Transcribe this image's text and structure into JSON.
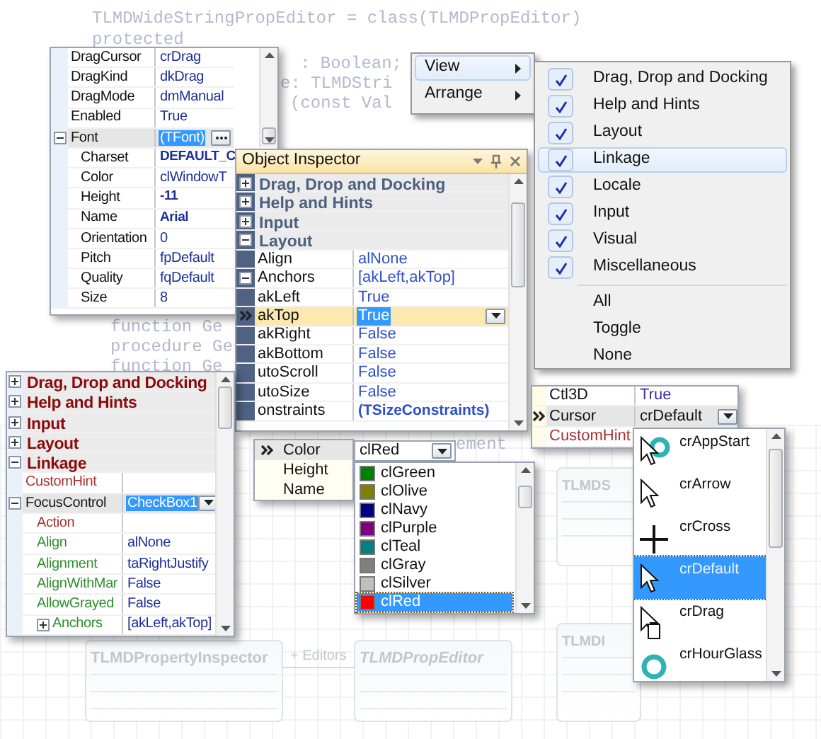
{
  "background_code": [
    "TLMDWideStringPropEditor = class(TLMDPropEditor)",
    "protected",
    ": Boolean;",
    "e: TLMDStri",
    "(const Val",
    "function Ge",
    "procedure Ge",
    "function Ge",
    "ement"
  ],
  "class_diagram": {
    "classes": [
      "TLMDPropertyInspector",
      "TLMDPropEditor",
      "TLMDS",
      "TLMDI"
    ],
    "association_label": "+ Editors"
  },
  "font_properties": {
    "rows": [
      {
        "name": "DragCursor",
        "value": "crDrag",
        "selected": false
      },
      {
        "name": "DragKind",
        "value": "dkDrag",
        "selected": false
      },
      {
        "name": "DragMode",
        "value": "dmManual",
        "selected": false
      },
      {
        "name": "Enabled",
        "value": "True",
        "selected": false
      },
      {
        "name": "Font",
        "value": "(TFont)",
        "selected": true,
        "kind": "ellipsis",
        "expanded": true,
        "children": [
          {
            "name": "Charset",
            "value": "DEFAULT_C",
            "modified": true,
            "selected": false
          },
          {
            "name": "Color",
            "value": "clWindowT",
            "selected": false
          },
          {
            "name": "Height",
            "value": "-11",
            "modified": true,
            "selected": false
          },
          {
            "name": "Name",
            "value": "Arial",
            "modified": true,
            "selected": false
          },
          {
            "name": "Orientation",
            "value": "0",
            "selected": false
          },
          {
            "name": "Pitch",
            "value": "fpDefault",
            "selected": false
          },
          {
            "name": "Quality",
            "value": "fqDefault",
            "selected": false
          },
          {
            "name": "Size",
            "value": "8",
            "selected": false
          }
        ]
      }
    ]
  },
  "context_menu": {
    "items": [
      {
        "label": "View",
        "selected": true
      },
      {
        "label": "Arrange",
        "selected": false
      }
    ]
  },
  "view_submenu": {
    "items": [
      {
        "label": "Drag, Drop and Docking",
        "checked": true,
        "selected": false
      },
      {
        "label": "Help and Hints",
        "checked": true,
        "selected": false
      },
      {
        "label": "Layout",
        "checked": true,
        "selected": false
      },
      {
        "label": "Linkage",
        "checked": true,
        "selected": true
      },
      {
        "label": "Locale",
        "checked": true,
        "selected": false
      },
      {
        "label": "Input",
        "checked": true,
        "selected": false
      },
      {
        "label": "Visual",
        "checked": true,
        "selected": false
      },
      {
        "label": "Miscellaneous",
        "checked": true,
        "selected": false
      }
    ],
    "actions": [
      "All",
      "Toggle",
      "None"
    ]
  },
  "object_inspector": {
    "title": "Object Inspector",
    "categories": [
      {
        "name": "Drag, Drop and Docking",
        "expanded": false
      },
      {
        "name": "Help and Hints",
        "expanded": false
      },
      {
        "name": "Input",
        "expanded": false
      },
      {
        "name": "Layout",
        "expanded": true,
        "properties": [
          {
            "name": "Align",
            "value": "alNone",
            "selected": false
          },
          {
            "name": "Anchors",
            "value": "[akLeft,akTop]",
            "selected": false,
            "expanded": true,
            "children": [
              {
                "name": "akLeft",
                "value": "True",
                "selected": false
              },
              {
                "name": "akTop",
                "value": "True",
                "selected": true,
                "kind": "dropdown"
              },
              {
                "name": "akRight",
                "value": "False",
                "selected": false
              },
              {
                "name": "akBottom",
                "value": "False",
                "selected": false
              }
            ]
          },
          {
            "name": "utoScroll",
            "value": "False",
            "selected": false
          },
          {
            "name": "utoSize",
            "value": "False",
            "selected": false
          },
          {
            "name": "onstraints",
            "value": "(TSizeConstraints)",
            "modified": true,
            "selected": false
          }
        ]
      }
    ]
  },
  "linkage_inspector": {
    "categories": [
      {
        "name": "Drag, Drop and Docking",
        "expanded": false
      },
      {
        "name": "Help and Hints",
        "expanded": false
      },
      {
        "name": "Input",
        "expanded": false
      },
      {
        "name": "Layout",
        "expanded": false
      },
      {
        "name": "Linkage",
        "expanded": true,
        "properties": [
          {
            "name": "CustomHint",
            "color": "#a83232",
            "selected": false
          },
          {
            "name": "FocusControl",
            "value": "CheckBox1",
            "color": "#1a1a1a",
            "selected": true,
            "kind": "dropdown",
            "expanded": true,
            "children": [
              {
                "name": "Action",
                "color": "#a83232",
                "selected": false
              },
              {
                "name": "Align",
                "value": "alNone",
                "color": "#2f8f2f",
                "selected": false
              },
              {
                "name": "Alignment",
                "value": "taRightJustify",
                "color": "#2f8f2f",
                "selected": false
              },
              {
                "name": "AlignWithMar",
                "value": "False",
                "color": "#2f8f2f",
                "selected": false
              },
              {
                "name": "AllowGrayed",
                "value": "False",
                "color": "#2f8f2f",
                "selected": false
              },
              {
                "name": "Anchors",
                "value": "[akLeft,akTop]",
                "color": "#2f8f2f",
                "selected": false,
                "expanded": false
              }
            ]
          }
        ]
      }
    ]
  },
  "font_color_editor": {
    "properties": [
      {
        "name": "Color",
        "selected": true
      },
      {
        "name": "Height",
        "selected": false
      },
      {
        "name": "Name",
        "selected": false
      }
    ],
    "value": "clRed",
    "options": [
      {
        "label": "clGreen",
        "color": "#008000",
        "selected": false
      },
      {
        "label": "clOlive",
        "color": "#808000",
        "selected": false
      },
      {
        "label": "clNavy",
        "color": "#000080",
        "selected": false
      },
      {
        "label": "clPurple",
        "color": "#800080",
        "selected": false
      },
      {
        "label": "clTeal",
        "color": "#008080",
        "selected": false
      },
      {
        "label": "clGray",
        "color": "#808080",
        "selected": false
      },
      {
        "label": "clSilver",
        "color": "#c0c0c0",
        "selected": false
      },
      {
        "label": "clRed",
        "color": "#ff0000",
        "selected": true
      }
    ]
  },
  "cursor_editor": {
    "properties": [
      {
        "name": "Ctl3D",
        "value": "True",
        "selected": false
      },
      {
        "name": "Cursor",
        "value": "crDefault",
        "selected": true,
        "kind": "dropdown"
      },
      {
        "name": "CustomHint",
        "color": "#a83232",
        "selected": false
      }
    ],
    "options": [
      {
        "label": "crAppStart",
        "kind": "appstart",
        "selected": false
      },
      {
        "label": "crArrow",
        "kind": "arrow",
        "selected": false
      },
      {
        "label": "crCross",
        "kind": "cross",
        "selected": false
      },
      {
        "label": "crDefault",
        "kind": "arrow",
        "selected": true
      },
      {
        "label": "crDrag",
        "kind": "drag",
        "selected": false
      },
      {
        "label": "crHourGlass",
        "kind": "hourglass",
        "selected": false
      }
    ]
  }
}
